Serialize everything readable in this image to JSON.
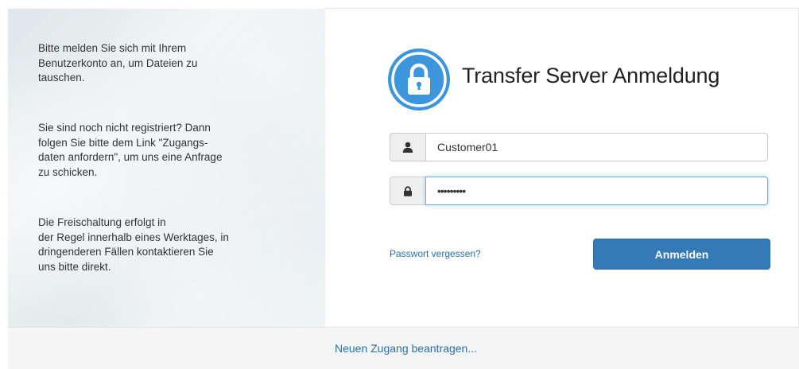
{
  "info_panel": {
    "paragraph_1": "Bitte melden Sie sich mit Ihrem\nBenutzerkonto an, um Dateien zu\ntauschen.",
    "paragraph_2": "Sie sind noch nicht registriert? Dann\nfolgen Sie bitte dem Link \"Zugangs-\ndaten anfordern\", um uns eine Anfrage\nzu schicken.",
    "paragraph_3": "Die Freischaltung erfolgt in\nder Regel innerhalb eines Werktages, in\ndringenderen Fällen kontaktieren Sie\nuns bitte direkt."
  },
  "login": {
    "title": "Transfer Server Anmeldung",
    "logo_icon": "lock-icon",
    "username": {
      "value": "Customer01",
      "icon": "user-icon"
    },
    "password": {
      "value": "•••••••••",
      "icon": "lock-icon"
    },
    "forgot_password_label": "Passwort vergessen?",
    "submit_label": "Anmelden"
  },
  "footer": {
    "register_link_label": "Neuen Zugang beantragen..."
  },
  "colors": {
    "accent": "#3d96dc",
    "button": "#337ab7",
    "link": "#2a6fa8"
  }
}
